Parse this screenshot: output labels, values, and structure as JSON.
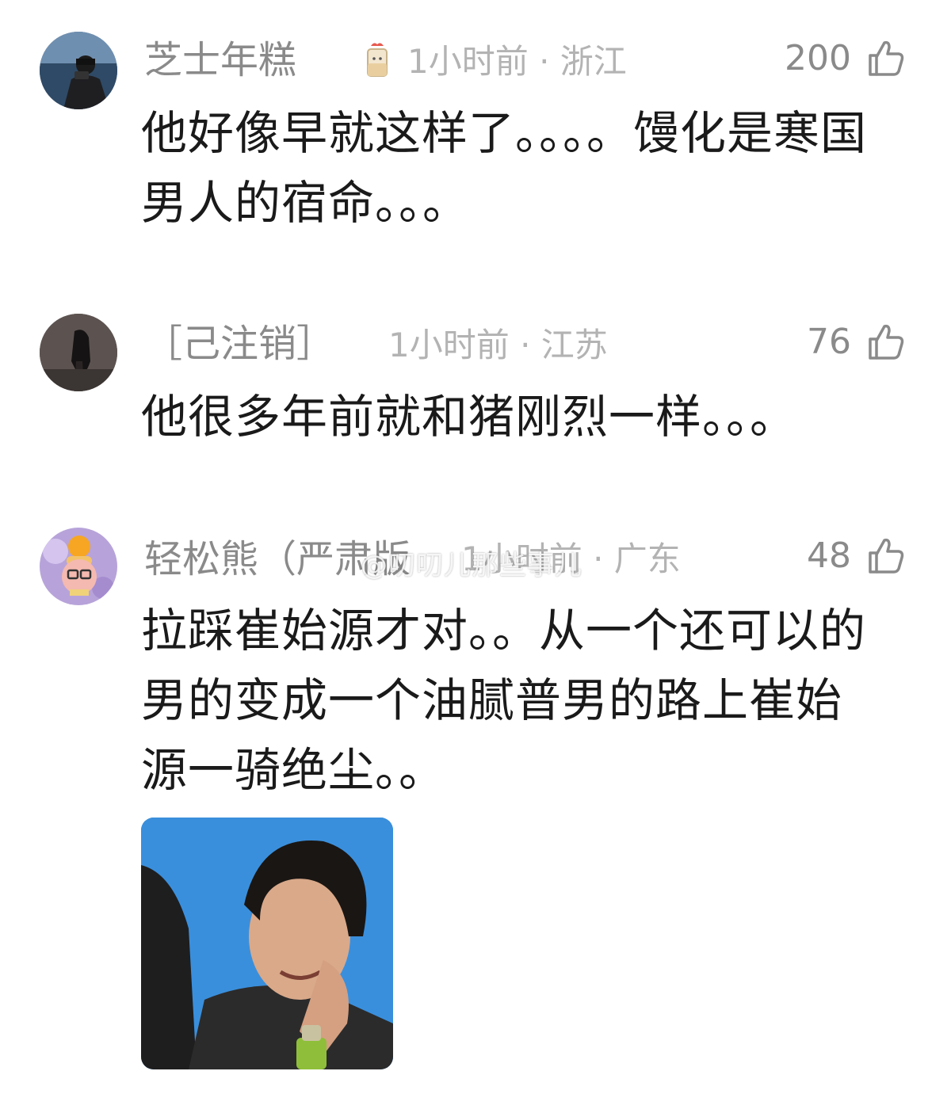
{
  "comments": [
    {
      "username": "芝士年糕",
      "badge_icon": "cake-cup-icon",
      "meta": "1小时前 · 浙江",
      "likes": "200",
      "text": "他好像早就这样了。。。。馒化是寒国男人的宿命。。。"
    },
    {
      "username": "［己注销］",
      "meta": "1小时前 · 江苏",
      "likes": "76",
      "text": "他很多年前就和猪刚烈一样。。。"
    },
    {
      "username": "轻松熊（严肃版",
      "meta": "1小时前 · 广东",
      "likes": "48",
      "text": "拉踩崔始源才对。。从一个还可以的男的变成一个油腻普男的路上崔始源一骑绝尘。。"
    }
  ],
  "watermark": "@叨叨儿那些事儿",
  "colors": {
    "username": "#8a8a8a",
    "meta": "#b3b3b3",
    "text": "#1a1a1a",
    "background": "#ffffff"
  },
  "icons": {
    "like": "thumbs-up-icon"
  }
}
